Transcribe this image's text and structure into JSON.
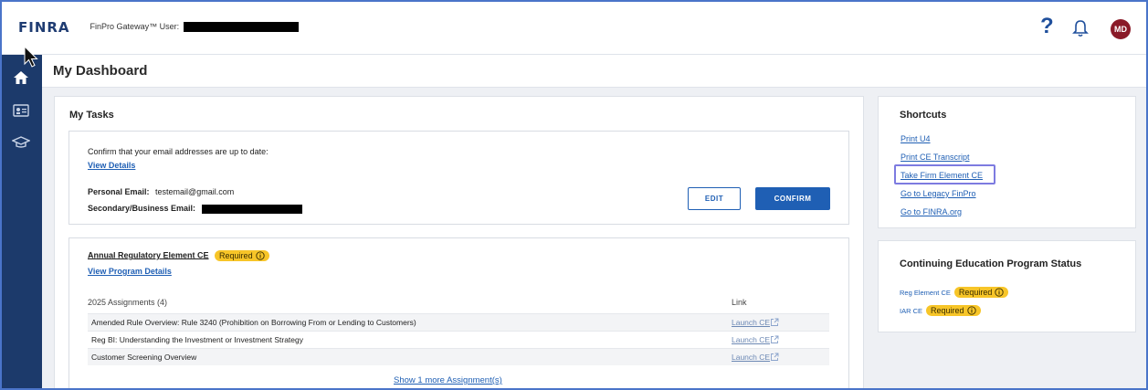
{
  "header": {
    "logo": "FINRA",
    "gateway_label": "FinPro Gateway™ User:",
    "help_symbol": "?",
    "avatar_initials": "MD"
  },
  "sidebar": {
    "items": [
      {
        "icon": "home-icon"
      },
      {
        "icon": "id-card-icon"
      },
      {
        "icon": "graduation-cap-icon"
      }
    ]
  },
  "dashboard": {
    "title": "My Dashboard"
  },
  "tasks": {
    "title": "My Tasks",
    "email": {
      "question": "Confirm that your email addresses are up to date:",
      "view_details": "View Details",
      "personal_label": "Personal Email:",
      "personal_value": "testemail@gmail.com",
      "secondary_label": "Secondary/Business Email:",
      "edit_label": "EDIT",
      "confirm_label": "CONFIRM"
    },
    "regulatory": {
      "title": "Annual Regulatory Element CE",
      "badge": "Required",
      "view_program": "View Program Details",
      "assignments_header": "2025 Assignments (4)",
      "link_header": "Link",
      "assignments": [
        {
          "name": "Amended Rule Overview: Rule 3240 (Prohibition on Borrowing From or Lending to Customers)",
          "link": "Launch CE"
        },
        {
          "name": "Reg BI: Understanding the Investment or Investment Strategy",
          "link": "Launch CE"
        },
        {
          "name": "Customer Screening Overview",
          "link": "Launch CE"
        }
      ],
      "show_more": "Show 1 more Assignment(s)"
    }
  },
  "shortcuts": {
    "title": "Shortcuts",
    "items": [
      "Print U4",
      "Print CE Transcript",
      "Take Firm Element CE",
      "Go to Legacy FinPro",
      "Go to FINRA.org"
    ]
  },
  "ce_status": {
    "title": "Continuing Education Program Status",
    "rows": [
      {
        "label": "Reg Element CE",
        "badge": "Required"
      },
      {
        "label": "IAR CE",
        "badge": "Required"
      }
    ]
  },
  "colors": {
    "primary": "#1f5fb4",
    "sidebar": "#1c3a6b",
    "badge": "#f7c528",
    "avatar": "#8a1a28"
  }
}
